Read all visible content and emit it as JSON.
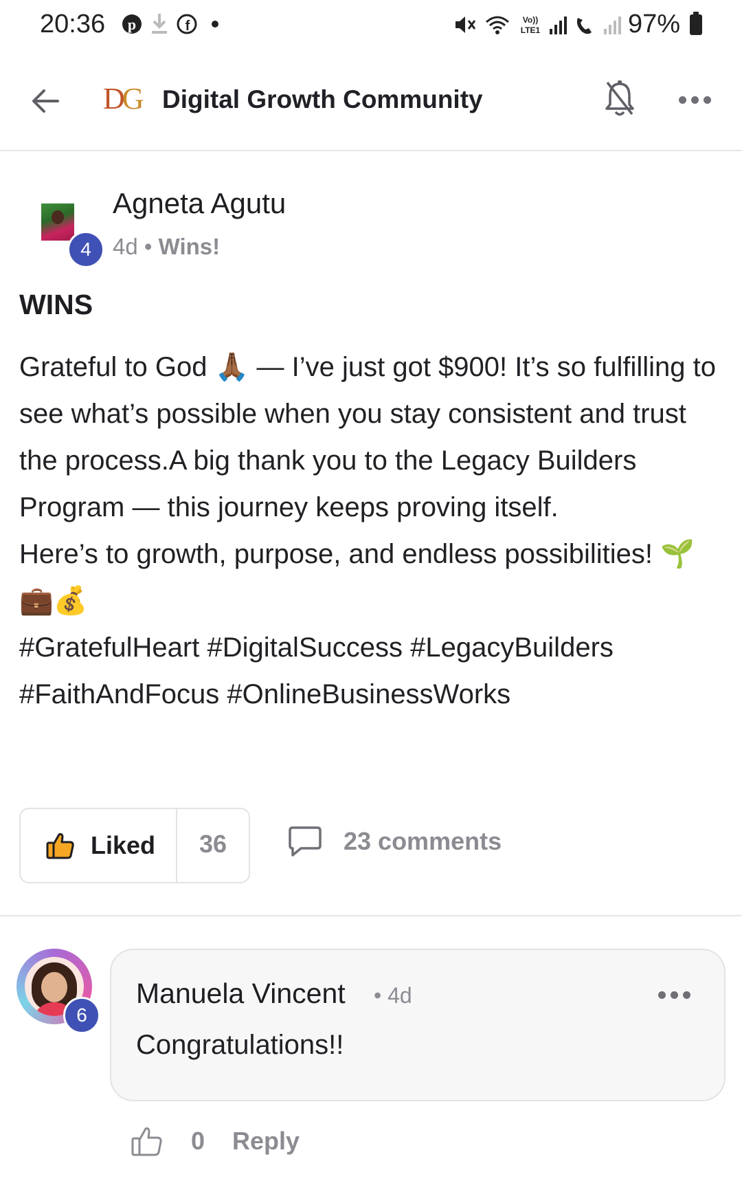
{
  "status_bar": {
    "time": "20:36",
    "battery": "97%"
  },
  "header": {
    "title": "Digital Growth Community",
    "logo_text": "DG"
  },
  "post": {
    "author": "Agneta Agutu",
    "level": "4",
    "age": "4d",
    "separator": " • ",
    "category": "Wins!",
    "title": "WINS",
    "paragraphs": [
      "Grateful to God 🙏🏾 — I’ve just got $900! It’s so fulfilling to see what’s possible when you stay consistent and trust the process.A big thank you to the Legacy Builders Program — this journey keeps proving itself.",
      "Here’s to growth, purpose, and endless possibilities! 🌱💼💰",
      "#GratefulHeart #DigitalSuccess #LegacyBuilders #FaithAndFocus #OnlineBusinessWorks"
    ],
    "like_label": "Liked",
    "like_count": "36",
    "comments_label": "23 comments"
  },
  "comment": {
    "author": "Manuela Vincent",
    "level": "6",
    "time": "• 4d",
    "text": "Congratulations!!",
    "like_count": "0",
    "reply_label": "Reply"
  },
  "icons": {
    "back": "arrow-left-icon",
    "notifications": "bell-off-icon",
    "more": "more-horizontal-icon",
    "like": "thumbs-up-icon",
    "comment": "comment-bubble-icon"
  }
}
